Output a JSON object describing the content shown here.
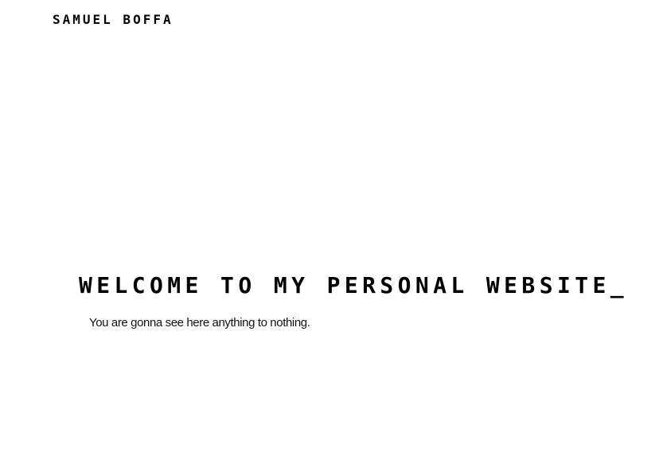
{
  "header": {
    "site_name": "SAMUEL BOFFA"
  },
  "hero": {
    "title": "WELCOME TO MY PERSONAL WEBSITE",
    "cursor": "_",
    "subtitle": "You are gonna see here anything to nothing."
  },
  "colors": {
    "background": "#ffffff",
    "text": "#000000"
  }
}
